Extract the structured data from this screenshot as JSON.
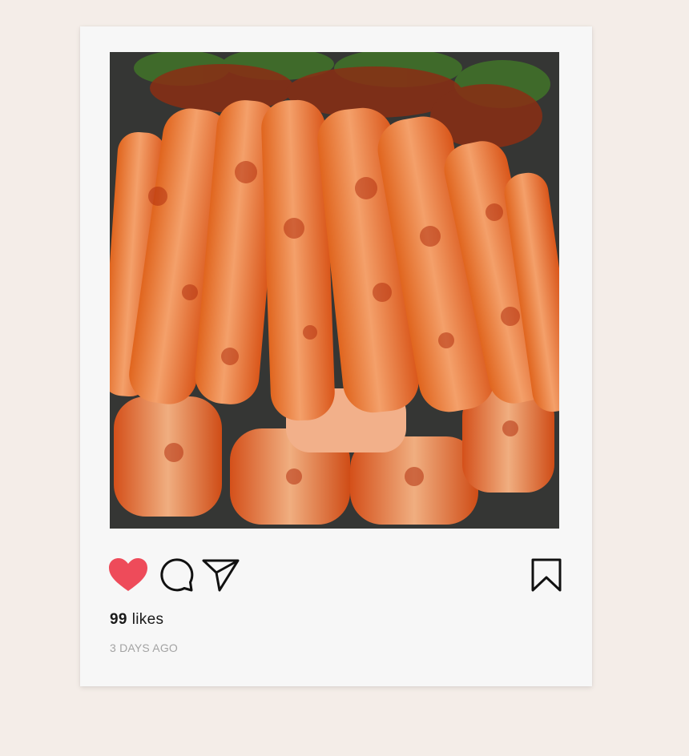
{
  "post": {
    "image_alt": "Kimchi photo",
    "likes_count": "99",
    "likes_label": "likes",
    "timestamp": "3 DAYS AGO",
    "liked": true
  },
  "icons": {
    "like": "heart-icon",
    "comment": "comment-icon",
    "share": "send-icon",
    "save": "bookmark-icon"
  },
  "colors": {
    "background": "#f4ede8",
    "card": "#f7f7f7",
    "heart": "#ee4b5a",
    "icon_stroke": "#111111",
    "timestamp": "#a3a3a3"
  }
}
